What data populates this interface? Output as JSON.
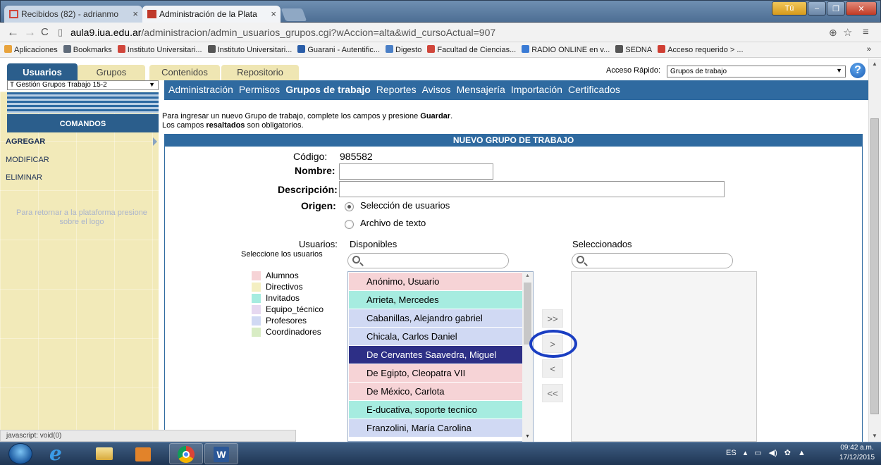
{
  "browser": {
    "tabs": [
      {
        "label": "Recibidos (82) - adrianmo",
        "active": false
      },
      {
        "label": "Administración de la Plata",
        "active": true
      }
    ],
    "window_user": "Tú",
    "url_host": "aula9.iua.edu.ar",
    "url_rest": "/administracion/admin_usuarios_grupos.cgi?wAccion=alta&wid_cursoActual=907",
    "bookmarks": [
      {
        "label": "Aplicaciones",
        "icon": "apps-grid-icon",
        "color": "#e8a33c"
      },
      {
        "label": "Bookmarks",
        "icon": "star-icon",
        "color": "#5f6b7a"
      },
      {
        "label": "Instituto Universitari...",
        "icon": "gmail-icon",
        "color": "#d0463b"
      },
      {
        "label": "Instituto Universitari...",
        "icon": "iua-logo-icon",
        "color": "#555"
      },
      {
        "label": "Guarani - Autentific...",
        "icon": "siu-icon",
        "color": "#2a5da8"
      },
      {
        "label": "Digesto",
        "icon": "doc-icon",
        "color": "#4a7fc6"
      },
      {
        "label": "Facultad de Ciencias...",
        "icon": "gmail-icon",
        "color": "#d0463b"
      },
      {
        "label": "RADIO ONLINE en v...",
        "icon": "play-icon",
        "color": "#3a7bd5"
      },
      {
        "label": "SEDNA",
        "icon": "iua-logo-icon",
        "color": "#555"
      },
      {
        "label": "Acceso requerido > ...",
        "icon": "chrome-icon",
        "color": "#cf3e33"
      }
    ],
    "bookmarks_more": "»",
    "status_text": "javascript: void(0)"
  },
  "app": {
    "tabs": [
      "Usuarios",
      "Grupos",
      "Contenidos",
      "Repositorio"
    ],
    "acceso_label": "Acceso Rápido:",
    "acceso_value": "Grupos de trabajo",
    "help": "?",
    "course": "T Gestión Grupos Trabajo 15-2",
    "menu": [
      {
        "label": "Administración",
        "active": false
      },
      {
        "label": "Permisos",
        "active": false
      },
      {
        "label": "Grupos de trabajo",
        "active": true
      },
      {
        "label": "Reportes",
        "active": false
      },
      {
        "label": "Avisos",
        "active": false
      },
      {
        "label": "Mensajería",
        "active": false
      },
      {
        "label": "Importación",
        "active": false
      },
      {
        "label": "Certificados",
        "active": false
      }
    ]
  },
  "sidebar": {
    "title": "COMANDOS",
    "items": [
      "AGREGAR",
      "MODIFICAR",
      "ELIMINAR"
    ],
    "info": "Para retornar a la plataforma presione sobre el logo"
  },
  "form": {
    "intro_1_pre": "Para ingresar un nuevo Grupo de trabajo, complete los campos y presione ",
    "intro_1_bold": "Guardar",
    "intro_1_post": ".",
    "intro_2_pre": "Los campos ",
    "intro_2_bold": "resaltados",
    "intro_2_post": " son obligatorios.",
    "title": "NUEVO GRUPO DE TRABAJO",
    "codigo_label": "Código:",
    "codigo_value": "985582",
    "nombre_label": "Nombre:",
    "nombre_value": "",
    "descripcion_label": "Descripción:",
    "descripcion_value": "",
    "origen_label": "Origen:",
    "origen_options": [
      "Selección de usuarios",
      "Archivo de texto"
    ],
    "origen_selected": "Selección de usuarios",
    "usuarios_label": "Usuarios:",
    "usuarios_hint": "Seleccione los usuarios",
    "disponibles_label": "Disponibles",
    "seleccionados_label": "Seleccionados",
    "legend": [
      {
        "label": "Alumnos",
        "color": "#f6d3d6"
      },
      {
        "label": "Directivos",
        "color": "#f4efc2"
      },
      {
        "label": "Invitados",
        "color": "#a6ece0"
      },
      {
        "label": "Equipo_técnico",
        "color": "#e6d8f0"
      },
      {
        "label": "Profesores",
        "color": "#d0d9f3"
      },
      {
        "label": "Coordinadores",
        "color": "#d8ecc4"
      }
    ],
    "disponibles": [
      {
        "name": "Anónimo, Usuario",
        "color": "#f6d3d6",
        "selected": false
      },
      {
        "name": "Arrieta, Mercedes",
        "color": "#a6ece0",
        "selected": false
      },
      {
        "name": "Cabanillas, Alejandro gabriel",
        "color": "#d0d9f3",
        "selected": false
      },
      {
        "name": "Chicala, Carlos Daniel",
        "color": "#d0d9f3",
        "selected": false
      },
      {
        "name": "De Cervantes Saavedra, Miguel",
        "color": "#2d2f86",
        "selected": true
      },
      {
        "name": "De Egipto, Cleopatra VII",
        "color": "#f6d3d6",
        "selected": false
      },
      {
        "name": "De México, Carlota",
        "color": "#f6d3d6",
        "selected": false
      },
      {
        "name": "E-ducativa, soporte tecnico",
        "color": "#a6ece0",
        "selected": false
      },
      {
        "name": "Franzolini, María Carolina",
        "color": "#d0d9f3",
        "selected": false
      }
    ],
    "move_buttons": [
      ">>",
      ">",
      "<",
      "<<"
    ]
  },
  "taskbar": {
    "language": "ES",
    "tray_icons": [
      "▴",
      "▭",
      "◀)",
      "✿",
      "▲"
    ],
    "time": "09:42 a.m.",
    "date": "17/12/2015"
  }
}
